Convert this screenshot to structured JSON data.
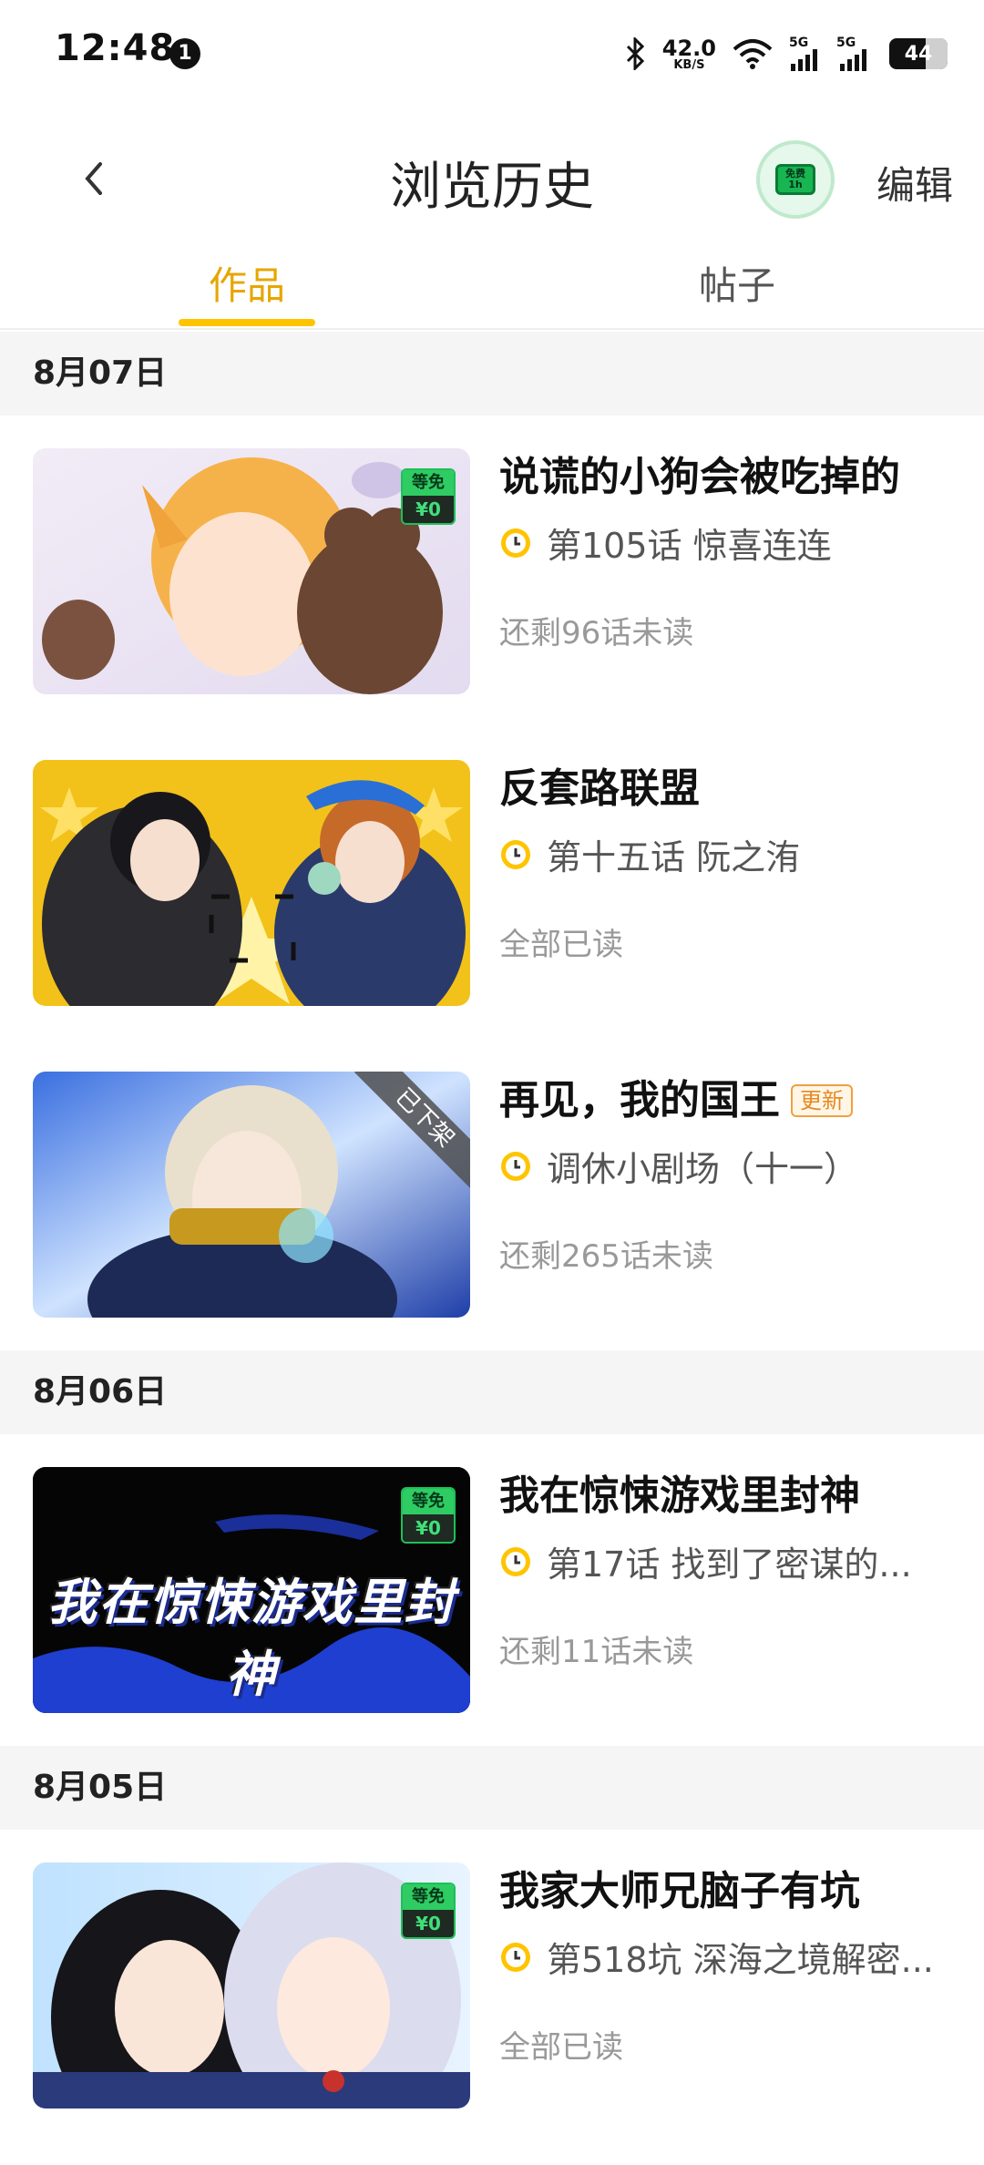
{
  "status_bar": {
    "time": "12:48",
    "notification_count": "1",
    "net_speed_value": "42.0",
    "net_speed_unit": "KB/S",
    "signal1_label": "5G",
    "signal2_label": "5G",
    "battery": "44"
  },
  "header": {
    "title": "浏览历史",
    "edit_label": "编辑",
    "timer_top": "免费",
    "timer_bottom": "1h"
  },
  "tabs": [
    {
      "label": "作品",
      "active": true
    },
    {
      "label": "帖子",
      "active": false
    }
  ],
  "history": [
    {
      "date": "8月07日",
      "items": [
        {
          "title": "说谎的小狗会被吃掉的",
          "chapter": "第105话 惊喜连连",
          "status": "还剩96话未读",
          "free_top": "等免",
          "free_bottom": "¥0",
          "has_free_tag": true
        },
        {
          "title": "反套路联盟",
          "chapter": "第十五话 阮之洧",
          "status": "全部已读"
        },
        {
          "title": "再见，我的国王",
          "badge": "更新",
          "ribbon": "已下架",
          "chapter": "调休小剧场（十一）",
          "status": "还剩265话未读"
        }
      ]
    },
    {
      "date": "8月06日",
      "items": [
        {
          "title": "我在惊悚游戏里封神",
          "cover_title": "我在惊悚游戏里封神",
          "chapter": "第17话 找到了密谋的...",
          "status": "还剩11话未读",
          "free_top": "等免",
          "free_bottom": "¥0"
        }
      ]
    },
    {
      "date": "8月05日",
      "items": [
        {
          "title": "我家大师兄脑子有坑",
          "chapter": "第518坑 深海之境解密...",
          "status": "全部已读",
          "free_top": "等免",
          "free_bottom": "¥0"
        }
      ]
    }
  ],
  "colors": {
    "accent": "#ffc400",
    "accent_text": "#e6a600",
    "date_bg": "#f5f5f5",
    "free_green": "#2ecc62"
  },
  "icons": [
    "back-chevron-icon",
    "bluetooth-icon",
    "wifi-icon",
    "signal-icon",
    "battery-icon",
    "clock-icon",
    "timer-icon"
  ]
}
